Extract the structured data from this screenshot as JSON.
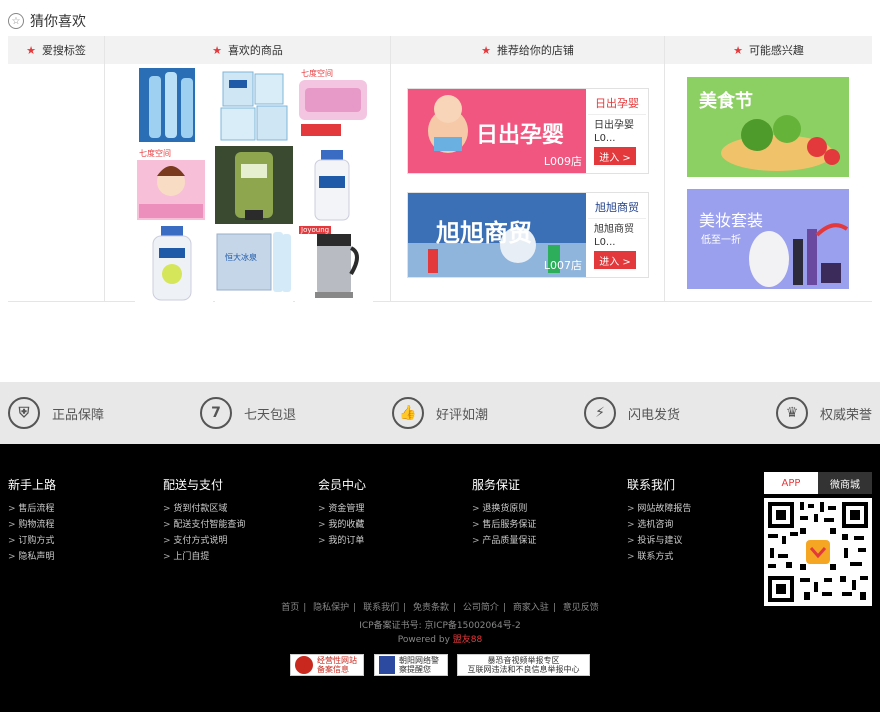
{
  "section": {
    "title": "猜你喜欢"
  },
  "columns": {
    "tags": "爱搜标签",
    "products": "喜欢的商品",
    "shops": "推荐给你的店铺",
    "interest": "可能感兴趣"
  },
  "products": [
    {
      "label": "",
      "name": "water-bottles"
    },
    {
      "label": "",
      "name": "tissue-packs"
    },
    {
      "label": "七度空间",
      "name": "sanitary-pads"
    },
    {
      "label": "七度空间",
      "name": "pads-box"
    },
    {
      "label": "",
      "name": "green-tube"
    },
    {
      "label": "",
      "name": "safeguard-bottle"
    },
    {
      "label": "",
      "name": "safeguard-lotion"
    },
    {
      "label": "恒大冰泉",
      "name": "water-case"
    },
    {
      "label": "Joyoung",
      "name": "soymilk-maker"
    }
  ],
  "shops": [
    {
      "banner_text": "日出孕婴",
      "logo_text": "日出孕婴",
      "name": "日出孕婴",
      "code": "L0...",
      "store_no": "L009店",
      "button": "进入 >"
    },
    {
      "banner_text": "旭旭商贸",
      "logo_text": "旭旭商贸",
      "name": "旭旭商贸",
      "code": "L0...",
      "store_no": "L007店",
      "button": "进入 >"
    }
  ],
  "interests": [
    {
      "title": "美食节",
      "subtitle": ""
    },
    {
      "title": "美妆套装",
      "subtitle": "低至一折"
    }
  ],
  "guarantees": [
    {
      "icon": "shield-icon",
      "glyph": "⛨",
      "label": "正品保障"
    },
    {
      "icon": "seven-icon",
      "glyph": "7",
      "label": "七天包退"
    },
    {
      "icon": "thumb-icon",
      "glyph": "👍",
      "label": "好评如潮"
    },
    {
      "icon": "lightning-icon",
      "glyph": "⚡",
      "label": "闪电发货"
    },
    {
      "icon": "crown-icon",
      "glyph": "♛",
      "label": "权威荣誉"
    }
  ],
  "footer": {
    "cols": [
      {
        "title": "新手上路",
        "items": [
          "售后流程",
          "购物流程",
          "订购方式",
          "隐私声明"
        ]
      },
      {
        "title": "配送与支付",
        "items": [
          "货到付款区域",
          "配送支付智能查询",
          "支付方式说明",
          "上门自提"
        ]
      },
      {
        "title": "会员中心",
        "items": [
          "资金管理",
          "我的收藏",
          "我的订单"
        ]
      },
      {
        "title": "服务保证",
        "items": [
          "退换货原则",
          "售后服务保证",
          "产品质量保证"
        ]
      },
      {
        "title": "联系我们",
        "items": [
          "网站故障报告",
          "选机咨询",
          "投诉与建议",
          "联系方式"
        ]
      }
    ],
    "tabs": [
      "APP",
      "微商城"
    ],
    "links": [
      "首页",
      "隐私保护",
      "联系我们",
      "免责条款",
      "公司简介",
      "商家入驻",
      "意见反馈"
    ],
    "icp": "ICP备案证书号: 京ICP备15002064号-2",
    "powered_prefix": "Powered by",
    "powered_brand": "盟友88",
    "badges": [
      {
        "line1": "经营性网站",
        "line2": "备案信息"
      },
      {
        "line1": "朝阳网络警",
        "line2": "察提醒您"
      },
      {
        "line1": "暴恐音视频举报专区",
        "line2": "互联网违法和不良信息举报中心"
      }
    ]
  },
  "colors": {
    "accent": "#e4393c",
    "footer_bg": "#000000",
    "bar_bg": "#e8e8e8"
  }
}
